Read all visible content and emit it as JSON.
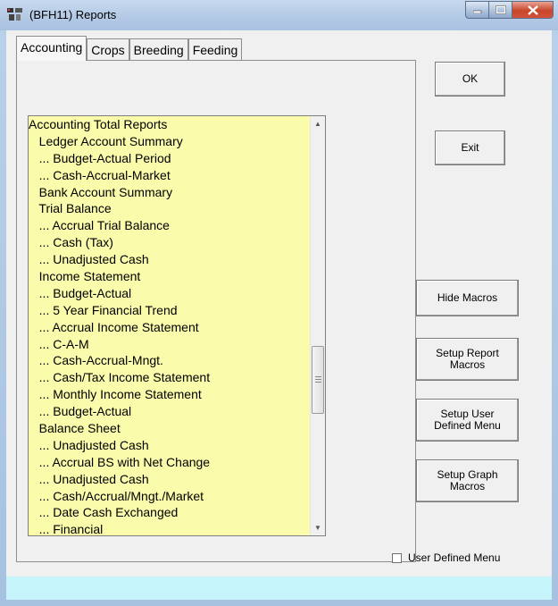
{
  "window": {
    "title": "(BFH11)  Reports",
    "minimize_icon": "minimize-icon",
    "maximize_icon": "maximize-icon",
    "close_icon": "close-icon"
  },
  "tabs": [
    {
      "label": "Accounting",
      "active": true
    },
    {
      "label": "Crops",
      "active": false
    },
    {
      "label": "Breeding",
      "active": false
    },
    {
      "label": "Feeding",
      "active": false
    }
  ],
  "report_list": {
    "items": [
      "Accounting Total Reports",
      "   Ledger Account Summary",
      "   ... Budget-Actual Period",
      "   ... Cash-Accrual-Market",
      "   Bank Account Summary",
      "   Trial Balance",
      "   ... Accrual Trial Balance",
      "   ... Cash (Tax)",
      "   ... Unadjusted Cash",
      "   Income Statement",
      "   ... Budget-Actual",
      "   ... 5 Year Financial Trend",
      "   ... Accrual Income Statement",
      "   ... C-A-M",
      "   ... Cash-Accrual-Mngt.",
      "   ... Cash/Tax Income Statement",
      "   ... Monthly Income Statement",
      "   ... Budget-Actual",
      "   Balance Sheet",
      "   ... Unadjusted Cash",
      "   ... Accrual BS with Net Change",
      "   ... Unadjusted Cash",
      "   ... Cash/Accrual/Mngt./Market",
      "   ... Date Cash Exchanged",
      "   ... Financial"
    ],
    "background_color": "#fbfbac"
  },
  "buttons": {
    "ok": "OK",
    "exit": "Exit",
    "hide_macros": "Hide Macros",
    "setup_report_macros": "Setup Report\nMacros",
    "setup_user_defined_menu": "Setup User\nDefined Menu",
    "setup_graph_macros": "Setup Graph\nMacros"
  },
  "checkbox": {
    "label": "User Defined Menu",
    "checked": false
  },
  "colors": {
    "status_strip": "#c6f4fb",
    "close_button": "#c8452b"
  }
}
